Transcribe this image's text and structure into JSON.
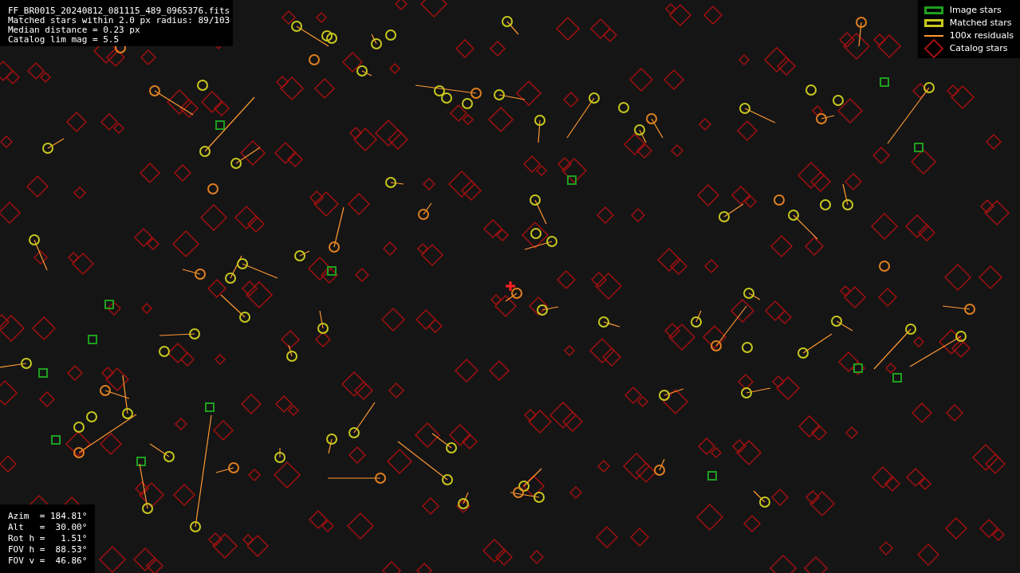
{
  "info": [
    "FF_BR0015_20240812_081115_489_0965376.fits",
    "Matched stars within 2.0 px radius: 89/103",
    "Median distance = 0.23 px",
    "Catalog lim mag = 5.5"
  ],
  "legend": [
    {
      "kind": "box",
      "color": "#1f9e1f",
      "label": "Image stars"
    },
    {
      "kind": "box",
      "color": "#c8c81e",
      "label": "Matched stars"
    },
    {
      "kind": "line",
      "color": "#ff9933",
      "label": "100x residuals"
    },
    {
      "kind": "diamond",
      "color": "#a01010",
      "label": "Catalog stars"
    }
  ],
  "pointing": [
    "Azim  = 184.81°",
    "Alt   =  30.00°",
    "Rot h =   1.51°",
    "FOV h =  88.53°",
    "FOV v =  46.86°"
  ]
}
